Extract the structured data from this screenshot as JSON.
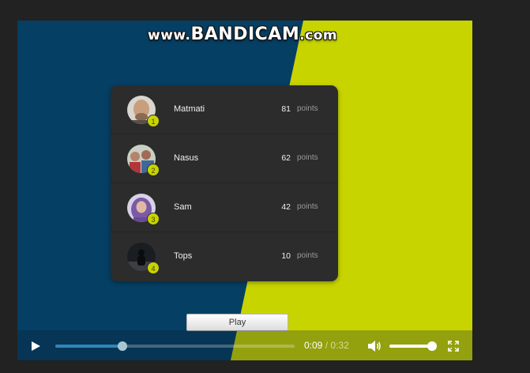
{
  "watermark": {
    "prefix": "www.",
    "brand": "BANDICAM",
    "suffix": ".com"
  },
  "leaderboard": [
    {
      "rank": "1",
      "name": "Matmati",
      "score": "81",
      "unit": "points",
      "avatar": "bald-man-photo"
    },
    {
      "rank": "2",
      "name": "Nasus",
      "score": "62",
      "unit": "points",
      "avatar": "group-photo"
    },
    {
      "rank": "3",
      "name": "Sam",
      "score": "42",
      "unit": "points",
      "avatar": "woman-hijab-photo"
    },
    {
      "rank": "4",
      "name": "Tops",
      "score": "10",
      "unit": "points",
      "avatar": "dark-silhouette-photo"
    }
  ],
  "play_button": {
    "label": "Play"
  },
  "player": {
    "current_time": "0:09",
    "separator": "/",
    "duration": "0:32",
    "progress_fraction": 0.28,
    "volume_fraction": 1.0,
    "icons": {
      "play": "play-icon",
      "volume": "volume-icon",
      "fullscreen": "fullscreen-icon"
    }
  },
  "colors": {
    "navy": "#053f63",
    "lime": "#c8d400",
    "panel": "#2c2c2c",
    "progress": "#2f86b8"
  }
}
